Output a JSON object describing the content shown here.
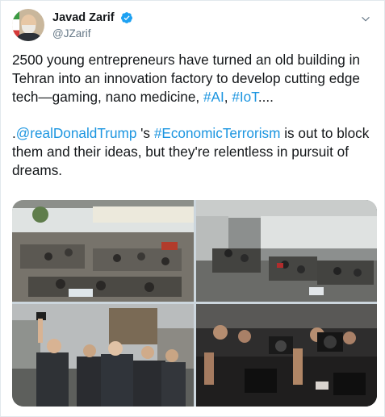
{
  "author": {
    "display_name": "Javad Zarif",
    "handle": "@JZarif",
    "verified_icon": "verified-badge-icon",
    "avatar_icon": "avatar",
    "menu_icon": "chevron-down-icon"
  },
  "tweet": {
    "para1": {
      "text": "2500 young entrepreneurs have turned an old building in Tehran into an innovation factory to develop cutting edge tech—gaming, nano medicine, ",
      "hashtag_ai": "#AI",
      "sep": ", ",
      "hashtag_iot": "#IoT",
      "end": "...."
    },
    "para2": {
      "lead": ".",
      "mention": "@realDonaldTrump",
      "mid": " 's ",
      "hashtag": "#EconomicTerrorism",
      "rest": " is out to block them and their ideas, but they're relentless in pursuit of dreams."
    }
  },
  "media": {
    "photos": [
      "photo-office-floor",
      "photo-office-open-space",
      "photo-group-selfie",
      "photo-press-cameras"
    ]
  },
  "colors": {
    "link": "#1b95e0",
    "text": "#14171a",
    "secondary": "#657786",
    "verified": "#1da1f2"
  }
}
